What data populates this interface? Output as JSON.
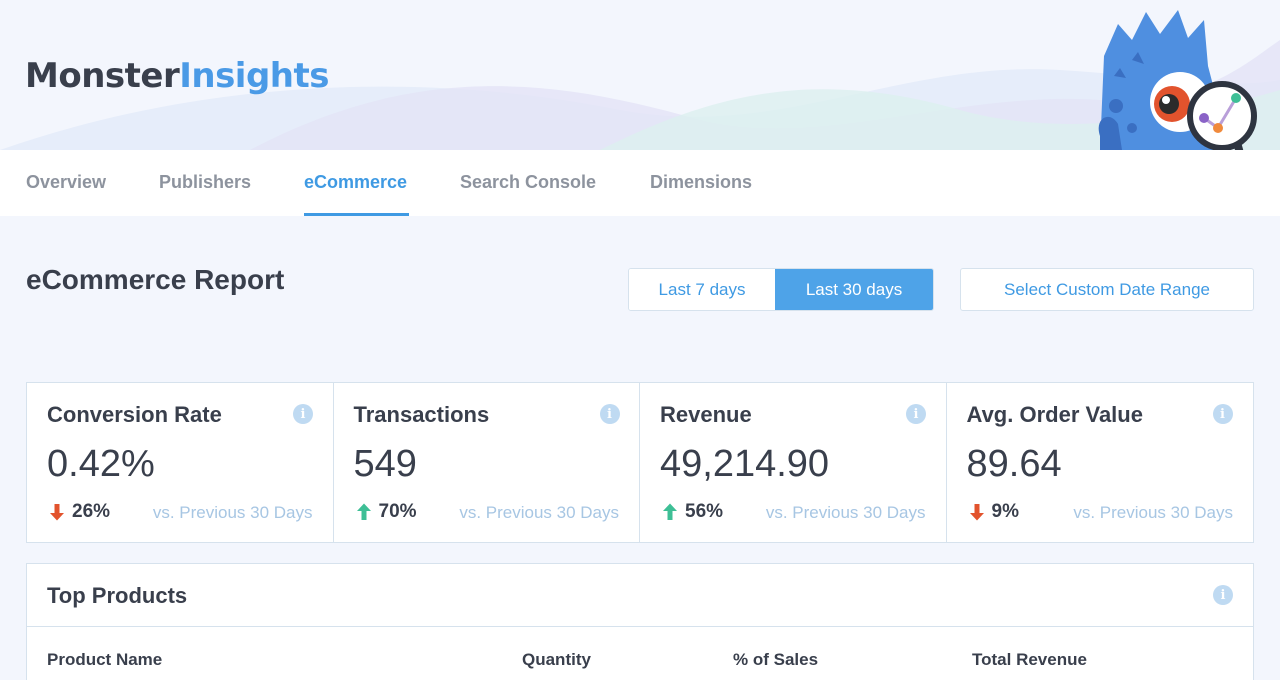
{
  "brand": {
    "part1": "Monster",
    "part2": "Insights"
  },
  "tabs": [
    {
      "label": "Overview"
    },
    {
      "label": "Publishers"
    },
    {
      "label": "eCommerce"
    },
    {
      "label": "Search Console"
    },
    {
      "label": "Dimensions"
    }
  ],
  "active_tab": "eCommerce",
  "report": {
    "title": "eCommerce Report",
    "range_options": [
      "Last 7 days",
      "Last 30 days"
    ],
    "selected_range": "Last 30 days",
    "custom_range_label": "Select Custom Date Range"
  },
  "stats": [
    {
      "label": "Conversion Rate",
      "value": "0.42%",
      "change": "26%",
      "direction": "down",
      "compare": "vs. Previous 30 Days"
    },
    {
      "label": "Transactions",
      "value": "549",
      "change": "70%",
      "direction": "up",
      "compare": "vs. Previous 30 Days"
    },
    {
      "label": "Revenue",
      "value": "49,214.90",
      "change": "56%",
      "direction": "up",
      "compare": "vs. Previous 30 Days"
    },
    {
      "label": "Avg. Order Value",
      "value": "89.64",
      "change": "9%",
      "direction": "down",
      "compare": "vs. Previous 30 Days"
    }
  ],
  "top_products": {
    "title": "Top Products",
    "columns": [
      "Product Name",
      "Quantity",
      "% of Sales",
      "Total Revenue"
    ]
  },
  "colors": {
    "accent": "#3f9ae3",
    "up": "#3ebf96",
    "down": "#e2532d",
    "text": "#393f4c"
  },
  "icons": {
    "info": "info-icon",
    "up": "arrow-up-icon",
    "down": "arrow-down-icon"
  }
}
